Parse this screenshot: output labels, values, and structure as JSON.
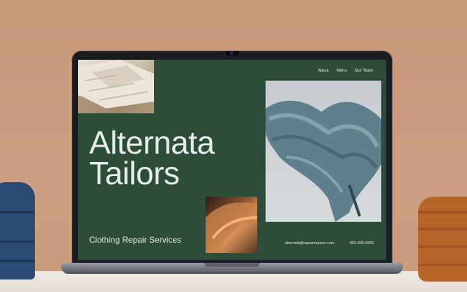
{
  "site": {
    "nav": [
      {
        "label": "About"
      },
      {
        "label": "Menu"
      },
      {
        "label": "Our Team"
      }
    ],
    "hero_title": "Alternata\nTailors",
    "subtitle": "Clothing Repair Services",
    "email": "alternata@squarespace.com",
    "phone": "555-555-5555"
  },
  "colors": {
    "site_background": "#2d4c3a",
    "text": "#e4eee6",
    "room_wall": "#c99b7d"
  },
  "icons": [
    "camera-icon"
  ]
}
